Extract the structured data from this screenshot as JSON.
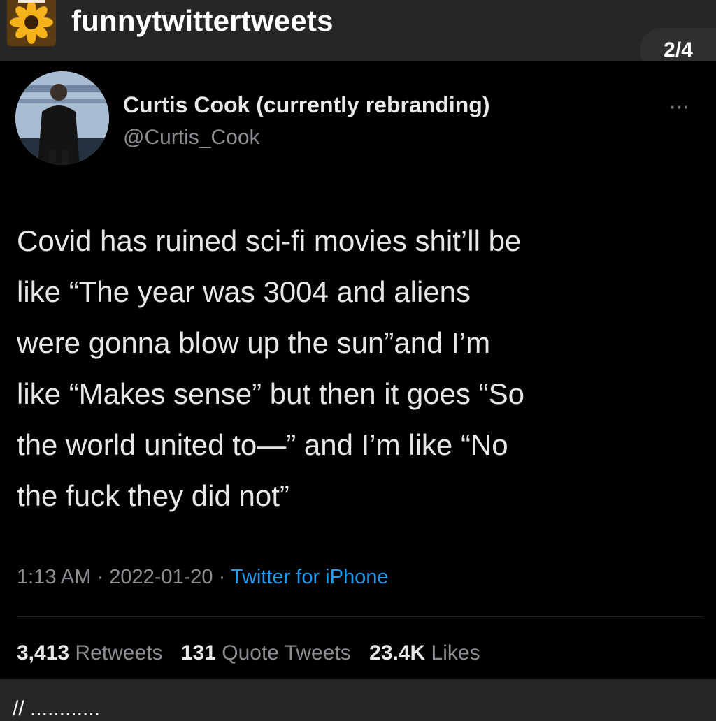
{
  "header": {
    "username": "funnytwittertweets",
    "page_indicator": "2/4"
  },
  "tweet": {
    "display_name": "Curtis Cook (currently rebranding)",
    "handle": "@Curtis_Cook",
    "more_icon": "ellipsis-icon",
    "text_lines": [
      "Covid has ruined sci-fi movies shit’ll be",
      "like “The year was 3004 and aliens",
      "were gonna blow up the sun”and I’m",
      "like “Makes sense” but then it goes “So",
      "the world united to—” and I’m like “No",
      "the fuck they did not”"
    ],
    "time": "1:13 AM",
    "date": "2022-01-20",
    "separator": "·",
    "source": "Twitter for iPhone",
    "source_color": "#1d9bf0",
    "retweets_count": "3,413",
    "retweets_label": "Retweets",
    "quotes_count": "131",
    "quotes_label": "Quote Tweets",
    "likes_count": "23.4K",
    "likes_label": "Likes"
  },
  "caption": {
    "text": "// ............"
  }
}
